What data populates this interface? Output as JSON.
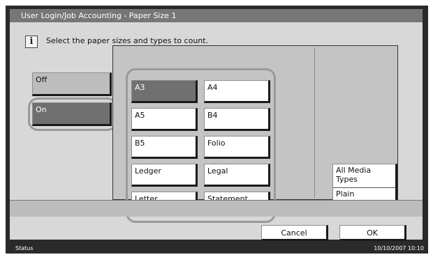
{
  "title": "User Login/Job Accounting - Paper Size 1",
  "message": "Select the paper sizes and types to count.",
  "info_icon": "i",
  "mode": {
    "off_label": "Off",
    "on_label": "On",
    "selected": "On"
  },
  "paper_sizes": [
    "A3",
    "A4",
    "A5",
    "B4",
    "B5",
    "Folio",
    "Ledger",
    "Legal",
    "Letter",
    "Statement"
  ],
  "media": {
    "type_label": "All Media Types",
    "value": "Plain"
  },
  "footer": {
    "cancel_label": "Cancel",
    "ok_label": "OK"
  },
  "status": {
    "label": "Status",
    "datetime": "10/10/2007  10:10"
  }
}
